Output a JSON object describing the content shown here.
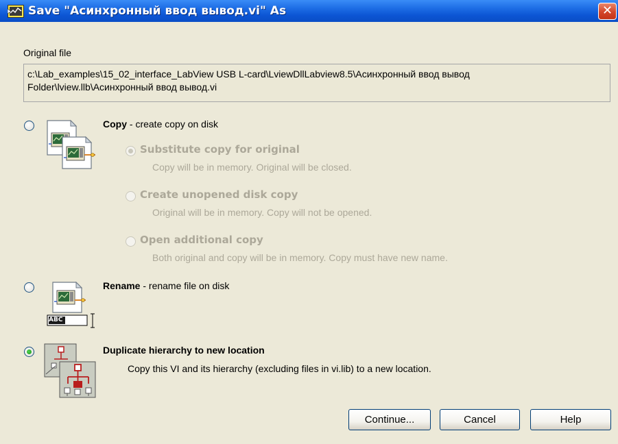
{
  "window": {
    "title": "Save \"Асинхронный ввод вывод.vi\" As",
    "close_glyph": "✕"
  },
  "original_file": {
    "label": "Original file",
    "path_line1": "c:\\Lab_examples\\15_02_interface_LabView USB L-card\\LviewDllLabview8.5\\Асинхронный ввод вывод",
    "path_line2": "Folder\\lview.llb\\Асинхронный ввод вывод.vi"
  },
  "options": {
    "copy": {
      "title": "Copy",
      "desc": " - create copy on disk",
      "selected": false,
      "icon": "vi-copy-icon",
      "sub": [
        {
          "title": "Substitute copy for original",
          "desc": "Copy will be in memory. Original will be closed.",
          "selected": true
        },
        {
          "title": "Create unopened disk copy",
          "desc": "Original will be in memory. Copy will not be opened.",
          "selected": false
        },
        {
          "title": "Open additional copy",
          "desc": "Both original and copy will be in memory. Copy must have new name.",
          "selected": false
        }
      ]
    },
    "rename": {
      "title": "Rename",
      "desc": " - rename file on disk",
      "selected": false,
      "icon": "vi-rename-icon",
      "abc_label": "ABC"
    },
    "duplicate": {
      "title": "Duplicate hierarchy to new location",
      "desc": "Copy this VI and its hierarchy (excluding files in vi.lib) to a new location.",
      "selected": true,
      "icon": "hierarchy-icon"
    }
  },
  "buttons": {
    "continue": "Continue...",
    "cancel": "Cancel",
    "help": "Help"
  },
  "colors": {
    "titlebar": "#0c55d4",
    "dialog_bg": "#ece9d8",
    "disabled_text": "#aca899",
    "radio_selected": "#169316"
  }
}
